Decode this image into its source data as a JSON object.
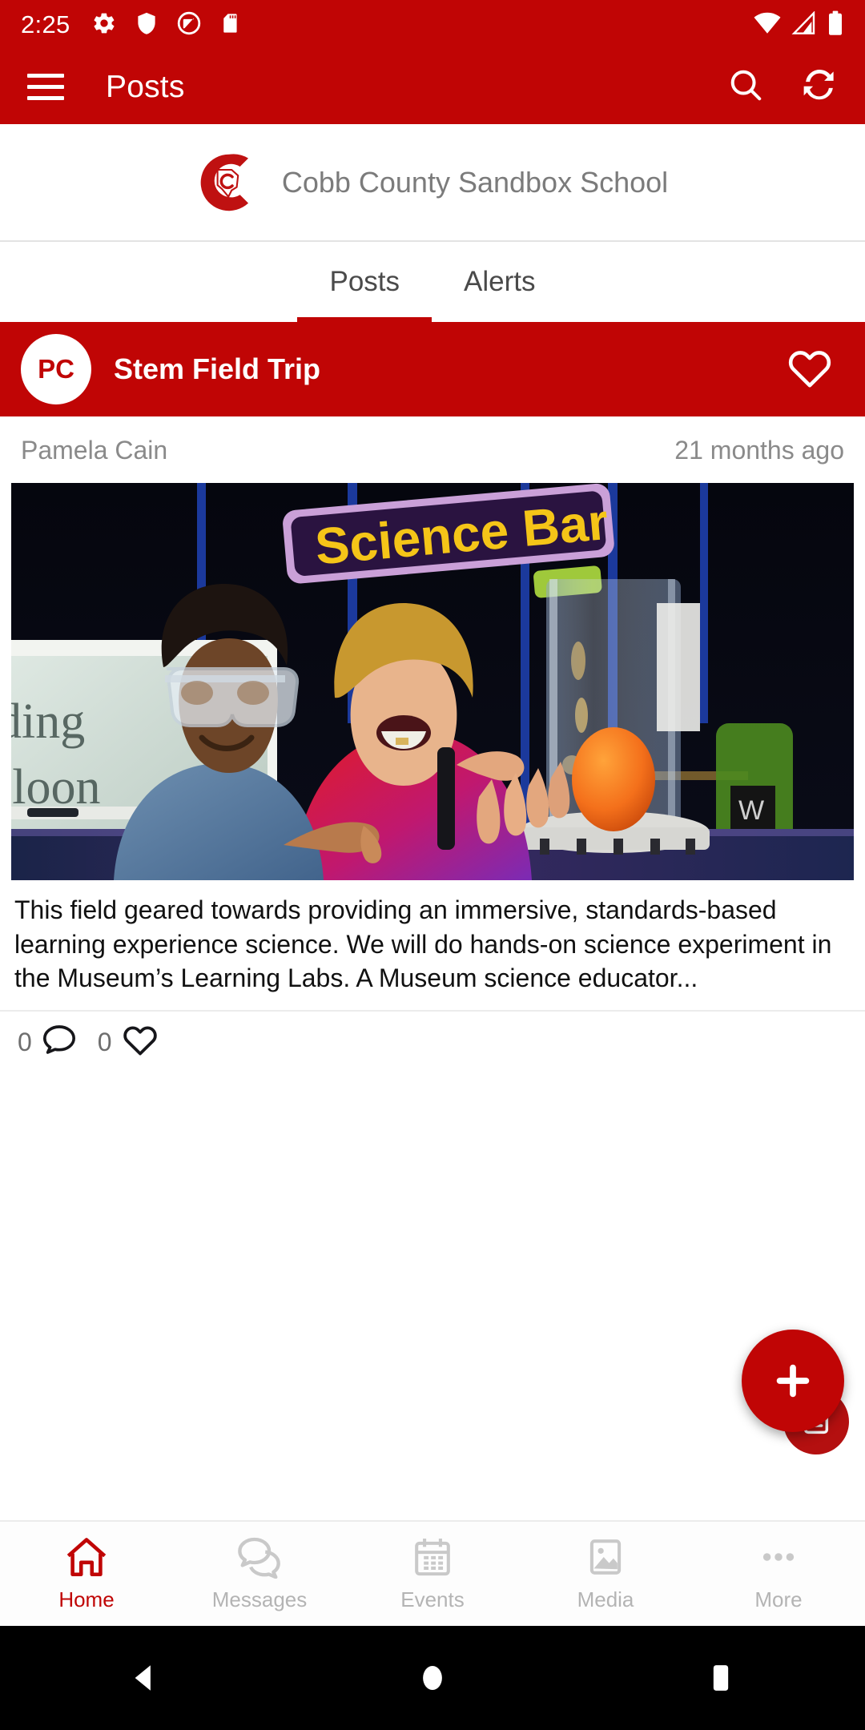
{
  "status_bar": {
    "time": "2:25",
    "left_icons": [
      "gear-icon",
      "shield-icon",
      "do-not-disturb-icon",
      "sd-card-icon"
    ],
    "right_icons": [
      "wifi-icon",
      "cell-signal-icon",
      "battery-icon"
    ]
  },
  "app_bar": {
    "title": "Posts",
    "menu_icon": "hamburger-menu-icon",
    "search_icon": "search-icon",
    "refresh_icon": "refresh-icon"
  },
  "school": {
    "name": "Cobb County Sandbox School",
    "logo": "cobb-county-logo"
  },
  "tabs": [
    {
      "label": "Posts",
      "active": true
    },
    {
      "label": "Alerts",
      "active": false
    }
  ],
  "post": {
    "avatar_initials": "PC",
    "title": "Stem Field Trip",
    "favorite_icon": "heart-outline-icon",
    "author": "Pamela Cain",
    "timestamp": "21 months ago",
    "body": "This field geared towards providing an immersive, standards-based learning experience science. We will do hands-on science experiment in the Museum’s Learning Labs. A Museum science educator...",
    "image_sign_text": "Science Bar",
    "image_board_text_1": "ding",
    "image_board_text_2": "lloon",
    "comment_count": "0",
    "like_count": "0",
    "comment_icon": "comment-bubble-icon",
    "like_icon": "heart-outline-icon"
  },
  "fab": {
    "icon": "plus-icon",
    "secondary_icon": "compose-icon"
  },
  "bottom_nav": [
    {
      "label": "Home",
      "icon": "home-icon",
      "active": true
    },
    {
      "label": "Messages",
      "icon": "messages-icon",
      "active": false
    },
    {
      "label": "Events",
      "icon": "calendar-icon",
      "active": false
    },
    {
      "label": "Media",
      "icon": "image-icon",
      "active": false
    },
    {
      "label": "More",
      "icon": "more-dots-icon",
      "active": false
    }
  ],
  "android_nav": {
    "back": "back-triangle-icon",
    "home": "home-circle-icon",
    "recents": "recents-square-icon"
  },
  "colors": {
    "brand_red": "#C00505",
    "muted_text": "#8a8a8a",
    "nav_inactive": "#b4b4b4"
  }
}
